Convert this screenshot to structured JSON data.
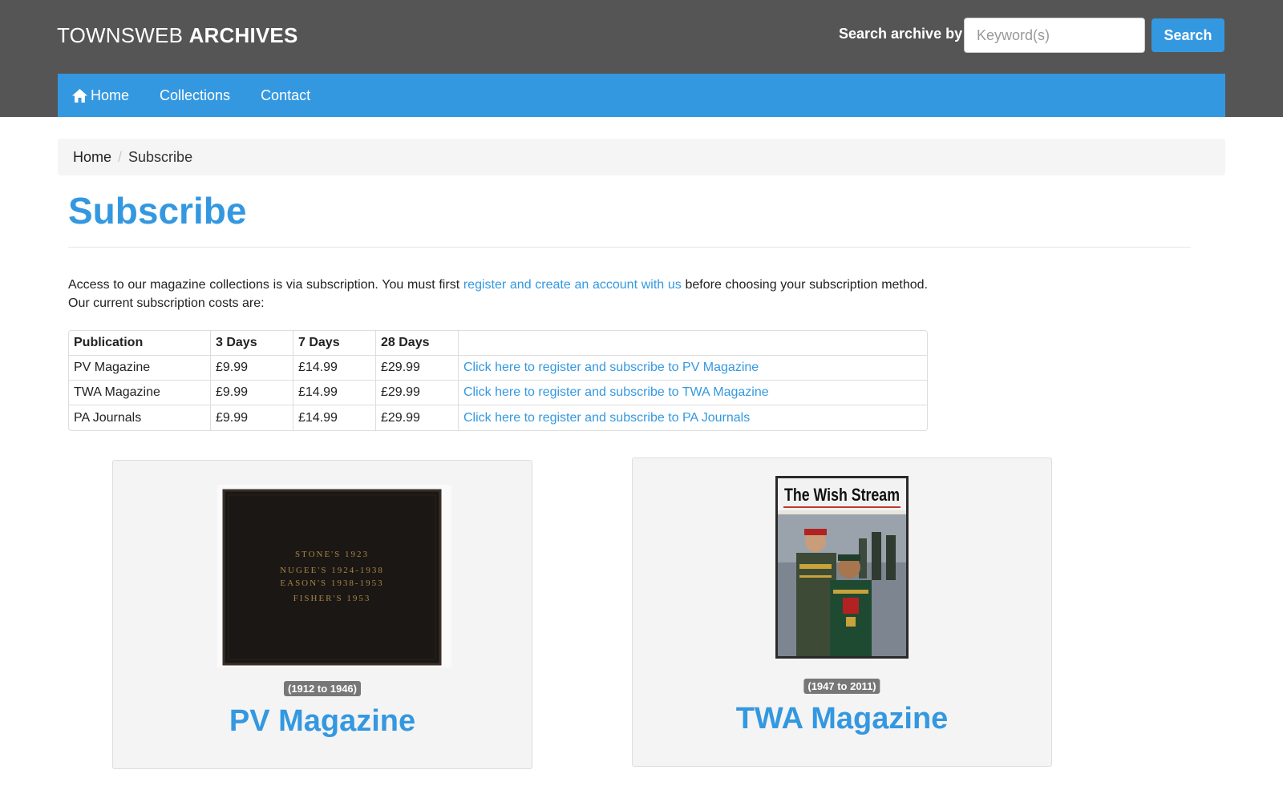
{
  "header": {
    "logo_regular": "TOWNSWEB",
    "logo_bold": "ARCHIVES",
    "search_label": "Search archive by",
    "search_placeholder": "Keyword(s)",
    "search_button": "Search"
  },
  "nav": {
    "items": [
      {
        "label": "Home",
        "icon": "home-icon"
      },
      {
        "label": "Collections"
      },
      {
        "label": "Contact"
      }
    ]
  },
  "breadcrumb": {
    "home": "Home",
    "separator": "/",
    "current": "Subscribe"
  },
  "page": {
    "title": "Subscribe",
    "intro_before": "Access to our magazine collections is via subscription. You must first ",
    "intro_link": "register and create an account with us",
    "intro_after": " before choosing your subscription method. Our current subscription costs are:"
  },
  "table": {
    "headers": [
      "Publication",
      "3 Days",
      "7 Days",
      "28 Days",
      ""
    ],
    "rows": [
      {
        "publication": "PV Magazine",
        "d3": "£9.99",
        "d7": "£14.99",
        "d28": "£29.99",
        "link": "Click here to register and subscribe to PV Magazine"
      },
      {
        "publication": "TWA Magazine",
        "d3": "£9.99",
        "d7": "£14.99",
        "d28": "£29.99",
        "link": "Click here to register and subscribe to TWA Magazine"
      },
      {
        "publication": "PA Journals",
        "d3": "£9.99",
        "d7": "£14.99",
        "d28": "£29.99",
        "link": "Click here to register and subscribe to PA Journals"
      }
    ]
  },
  "cards": [
    {
      "title": "PV Magazine",
      "badge": "(1912 to 1946)",
      "cover_lines": [
        "STONE'S   1923",
        "NUGEE'S   1924-1938",
        "EASON'S   1938-1953",
        "FISHER'S   1953"
      ]
    },
    {
      "title": "TWA Magazine",
      "badge": "(1947 to 2011)",
      "cover_title": "The Wish Stream"
    }
  ],
  "colors": {
    "accent": "#3498e0",
    "header_bg": "#555555",
    "badge_bg": "#777777"
  }
}
